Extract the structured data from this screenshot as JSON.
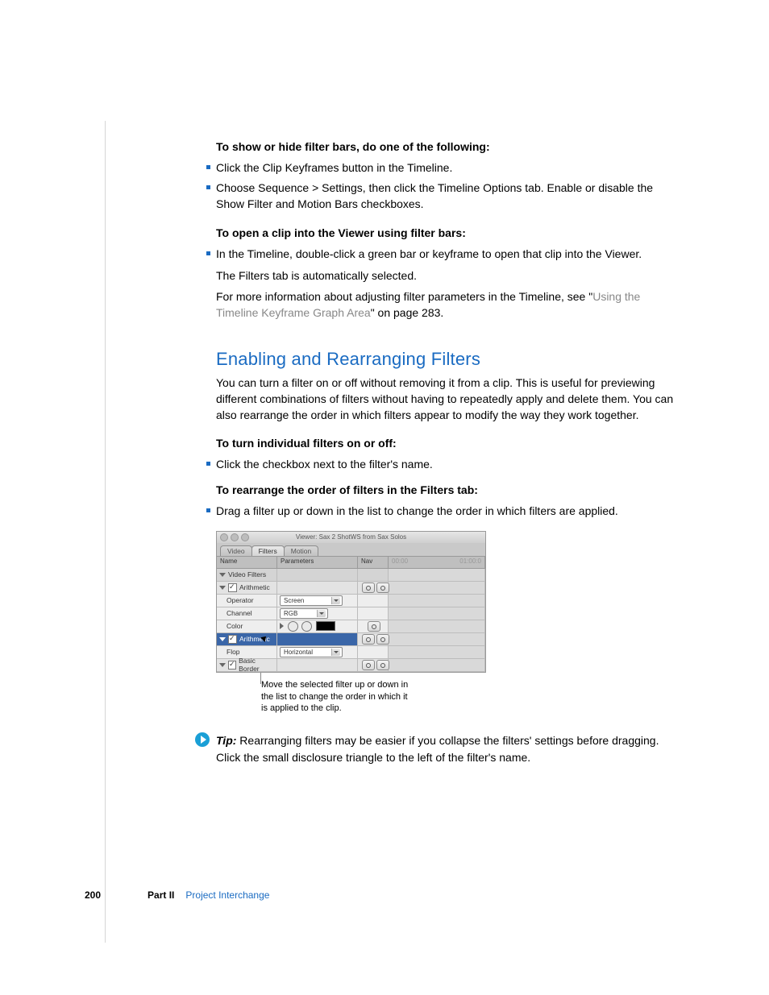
{
  "heading1": "To show or hide filter bars, do one of the following:",
  "b1": "Click the Clip Keyframes button in the Timeline.",
  "b2": "Choose Sequence > Settings, then click the Timeline Options tab. Enable or disable the Show Filter and Motion Bars checkboxes.",
  "heading2": "To open a clip into the Viewer using filter bars:",
  "b3": "In the Timeline, double-click a green bar or keyframe to open that clip into the Viewer.",
  "p1": "The Filters tab is automatically selected.",
  "p2a": "For more information about adjusting filter parameters in the Timeline, see \"",
  "p2link": "Using the Timeline Keyframe Graph Area",
  "p2b": "\" on page 283.",
  "sectionTitle": "Enabling and Rearranging Filters",
  "sectionIntro": "You can turn a filter on or off without removing it from a clip. This is useful for previewing different combinations of filters without having to repeatedly apply and delete them. You can also rearrange the order in which filters appear to modify the way they work together.",
  "heading3": "To turn individual filters on or off:",
  "b4": "Click the checkbox next to the filter's name.",
  "heading4": "To rearrange the order of filters in the Filters tab:",
  "b5": "Drag a filter up or down in the list to change the order in which filters are applied.",
  "fig": {
    "title": "Viewer: Sax 2 ShotWS from Sax Solos",
    "tabs": {
      "video": "Video",
      "filters": "Filters",
      "motion": "Motion"
    },
    "hdr": {
      "name": "Name",
      "params": "Parameters",
      "nav": "Nav"
    },
    "rows": {
      "videoFilters": "Video Filters",
      "arithmetic": "Arithmetic",
      "operator": "Operator",
      "operatorVal": "Screen",
      "channel": "Channel",
      "channelVal": "RGB",
      "color": "Color",
      "flop": "Flop",
      "flopVal": "Horizontal",
      "basicBorder": "Basic Border",
      "selDrag": "Arithmetic"
    },
    "tlStart": "00:00",
    "tlEnd": "01:00:0"
  },
  "caption": "Move the selected filter up or down in the list to change the order in which it is applied to the clip.",
  "tipLabel": "Tip:  ",
  "tipText": "Rearranging filters may be easier if you collapse the filters' settings before dragging. Click the small disclosure triangle to the left of the filter's name.",
  "footer": {
    "page": "200",
    "part": "Part II",
    "section": "Project Interchange"
  }
}
